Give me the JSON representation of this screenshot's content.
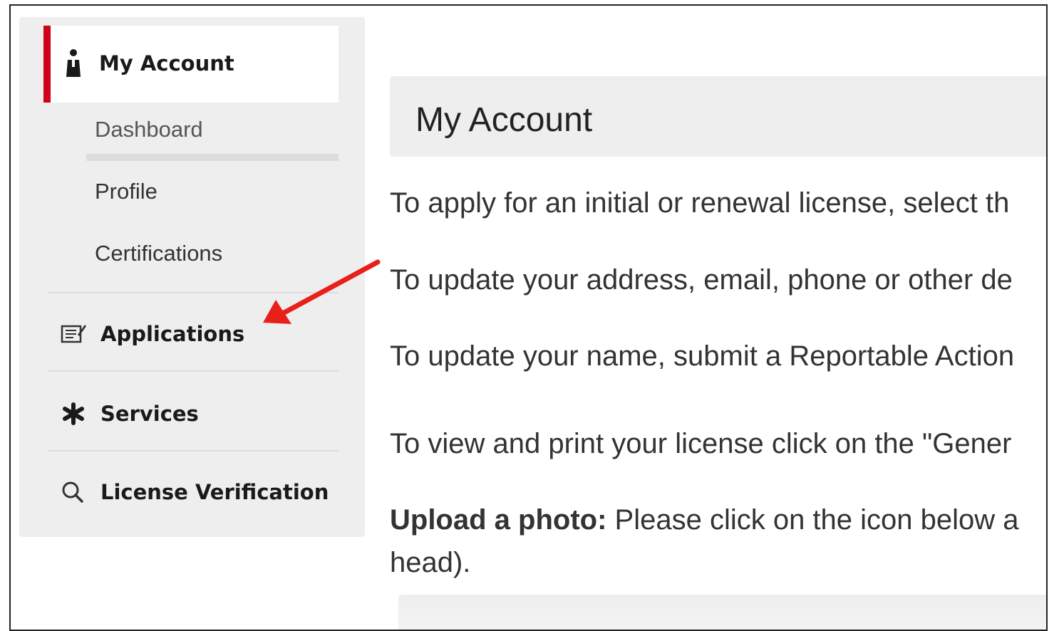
{
  "sidebar": {
    "header": {
      "label": "My Account",
      "icon": "person-icon"
    },
    "sub_items": [
      {
        "label": "Dashboard"
      },
      {
        "label": "Profile"
      },
      {
        "label": "Certifications"
      }
    ],
    "sections": [
      {
        "label": "Applications",
        "icon": "document-edit-icon"
      },
      {
        "label": "Services",
        "icon": "asterisk-icon"
      },
      {
        "label": "License Verification",
        "icon": "search-icon"
      }
    ],
    "active_accent": "#d0021b"
  },
  "main": {
    "title": "My Account",
    "paragraphs": [
      "To apply for an initial or renewal license, select th",
      "To update your address, email, phone or other de",
      "To update your name, submit a Reportable Action",
      "To view and print your license click on the \"Gener"
    ],
    "upload": {
      "label": "Upload a photo:",
      "text": " Please click on the icon below a",
      "text_line2": "head)."
    }
  },
  "annotation": {
    "arrow_color": "#e8201a"
  }
}
